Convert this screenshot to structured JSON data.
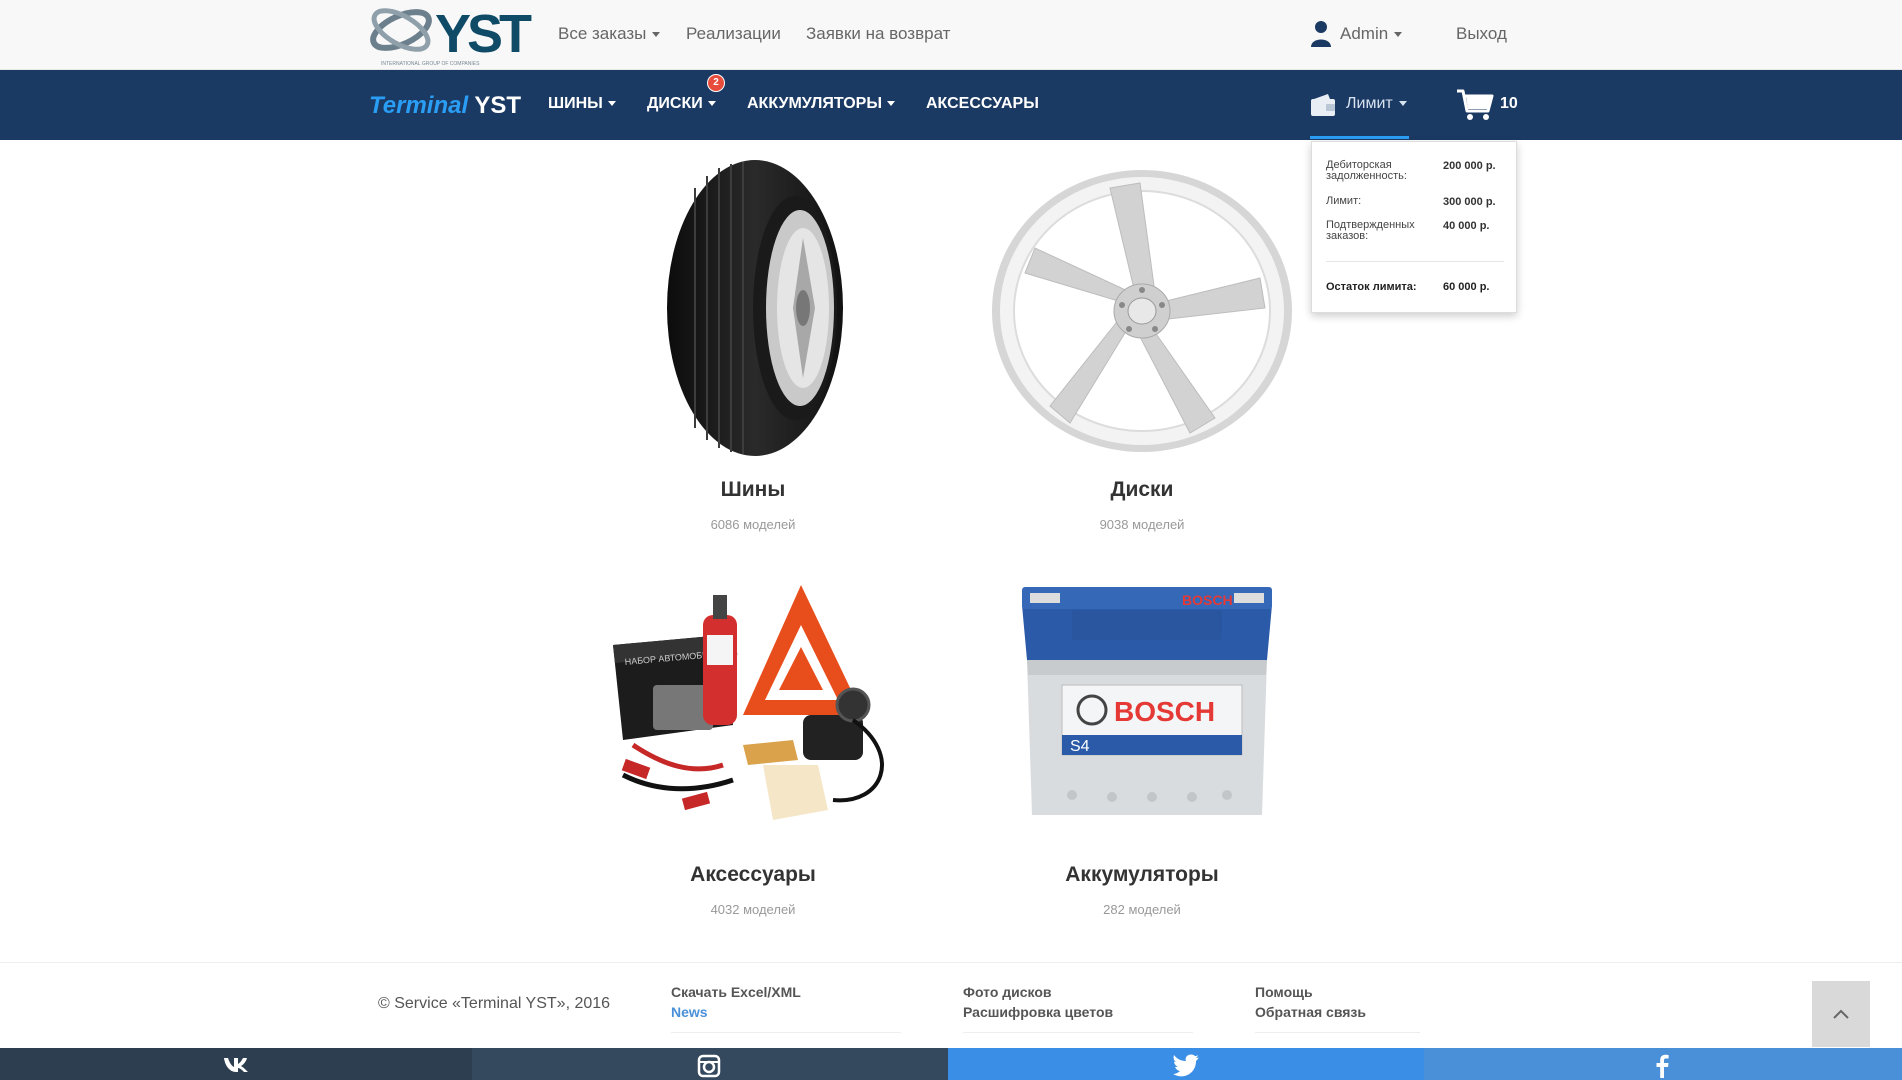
{
  "topbar": {
    "logo_text": "YST",
    "logo_sub": "INTERNATIONAL GROUP OF COMPANIES",
    "nav": [
      {
        "label": "Все заказы",
        "dropdown": true
      },
      {
        "label": "Реализации",
        "dropdown": false
      },
      {
        "label": "Заявки на возврат",
        "dropdown": false
      }
    ],
    "user_label": "Admin",
    "logout_label": "Выход"
  },
  "navbar": {
    "brand_part1": "Terminal",
    "brand_part2": "YST",
    "items": [
      {
        "label": "ШИНЫ",
        "dropdown": true
      },
      {
        "label": "ДИСКИ",
        "dropdown": true,
        "badge": "2"
      },
      {
        "label": "АККУМУЛЯТОРЫ",
        "dropdown": true
      },
      {
        "label": "АКСЕССУАРЫ",
        "dropdown": false
      }
    ],
    "limit_label": "Лимит",
    "cart_count": "10"
  },
  "limit_popup": {
    "rows": [
      {
        "label": "Дебиторская задолженность:",
        "value": "200 000 р."
      },
      {
        "label": "Лимит:",
        "value": "300 000 р."
      },
      {
        "label": "Подтвержденных заказов:",
        "value": "40 000 р."
      }
    ],
    "total_label": "Остаток лимита:",
    "total_value": "60 000 р."
  },
  "categories": [
    {
      "title": "Шины",
      "count": "6086 моделей",
      "icon": "tire-image"
    },
    {
      "title": "Диски",
      "count": "9038 моделей",
      "icon": "wheel-image"
    },
    {
      "title": "Аксессуары",
      "count": "4032 моделей",
      "icon": "accessories-image"
    },
    {
      "title": "Аккумуляторы",
      "count": "282 моделей",
      "icon": "battery-image"
    }
  ],
  "battery_brand": "BOSCH",
  "battery_model": "S4",
  "footer": {
    "copyright": "© Service «Terminal YST», 2016",
    "col1": [
      "Скачать Excel/XML",
      "News"
    ],
    "col2": [
      "Фото дисков",
      "Расшифровка цветов"
    ],
    "col3": [
      "Помощь",
      "Обратная связь"
    ]
  },
  "social": [
    {
      "name": "vk",
      "color": "#2c3e50"
    },
    {
      "name": "instagram",
      "color": "#34495e"
    },
    {
      "name": "twitter",
      "color": "#3a8ee6"
    },
    {
      "name": "facebook",
      "color": "#4a90d9"
    }
  ],
  "colors": {
    "navbar": "#1b3a63",
    "accent": "#2a9df4",
    "badge": "#e74c3c"
  }
}
